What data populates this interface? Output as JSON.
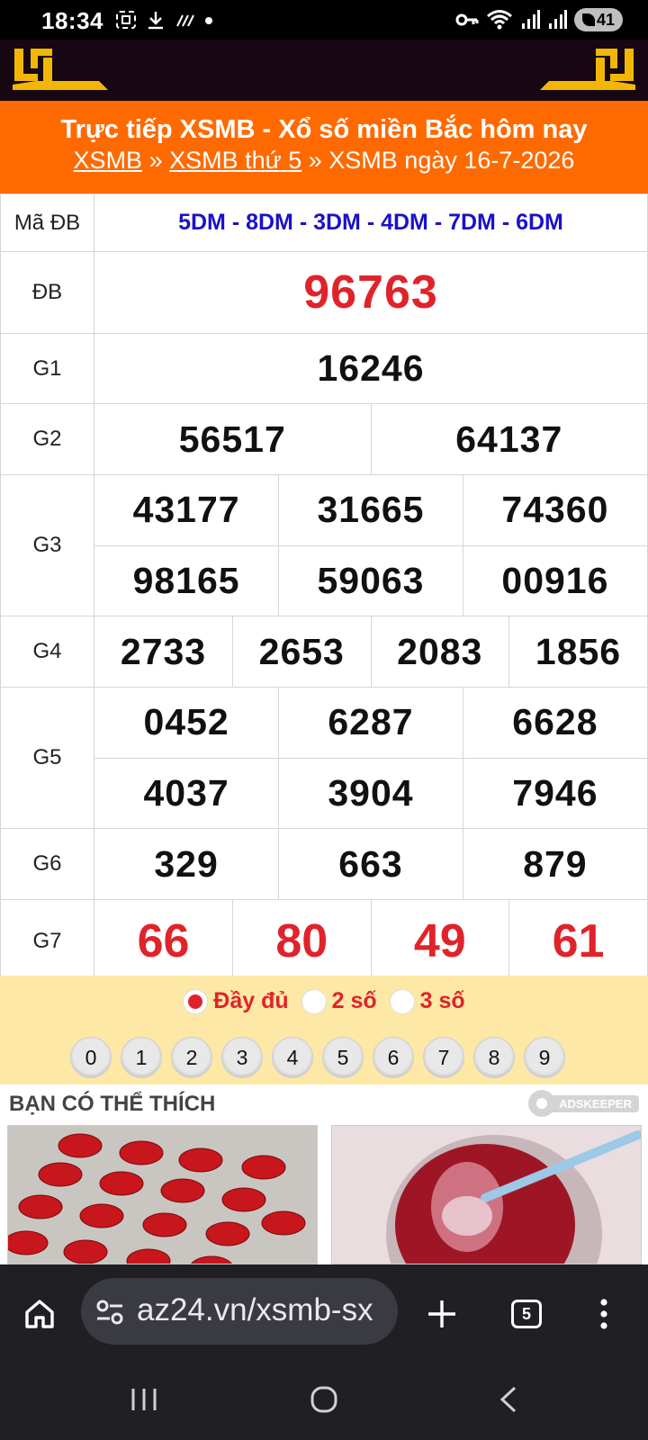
{
  "status_bar": {
    "time": "18:34",
    "battery": "41",
    "icons_left": [
      "screenshot-icon",
      "download-icon",
      "signal-hash-icon",
      "dot-icon"
    ],
    "icons_right": [
      "key-icon",
      "wifi-icon",
      "signal-icon",
      "signal-icon-2",
      "battery-icon"
    ]
  },
  "header": {
    "title": "Trực tiếp XSMB - Xổ số miền Bắc hôm nay",
    "breadcrumb": {
      "link1": "XSMB",
      "sep1": " » ",
      "link2": "XSMB thứ 5",
      "sep2": " » ",
      "current": "XSMB ngày 16-7-2026"
    }
  },
  "results": {
    "code_label": "Mã ĐB",
    "code_value": "5DM - 8DM - 3DM - 4DM - 7DM - 6DM",
    "db": {
      "label": "ĐB",
      "value": "96763"
    },
    "g1": {
      "label": "G1",
      "values": [
        "16246"
      ]
    },
    "g2": {
      "label": "G2",
      "values": [
        "56517",
        "64137"
      ]
    },
    "g3": {
      "label": "G3",
      "values": [
        "43177",
        "31665",
        "74360",
        "98165",
        "59063",
        "00916"
      ]
    },
    "g4": {
      "label": "G4",
      "values": [
        "2733",
        "2653",
        "2083",
        "1856"
      ]
    },
    "g5": {
      "label": "G5",
      "values": [
        "0452",
        "6287",
        "6628",
        "4037",
        "3904",
        "7946"
      ]
    },
    "g6": {
      "label": "G6",
      "values": [
        "329",
        "663",
        "879"
      ]
    },
    "g7": {
      "label": "G7",
      "values": [
        "66",
        "80",
        "49",
        "61"
      ]
    }
  },
  "filter": {
    "options": [
      "Đầy đủ",
      "2 số",
      "3 số"
    ],
    "selected": "Đầy đủ",
    "digits": [
      "0",
      "1",
      "2",
      "3",
      "4",
      "5",
      "6",
      "7",
      "8",
      "9"
    ]
  },
  "recommendations": {
    "title": "BẠN CÓ THỂ THÍCH",
    "ad_brand": "ADSKEEPER"
  },
  "browser": {
    "url": "az24.vn/xsmb-sx",
    "tab_count": "5"
  },
  "colors": {
    "header_orange": "#ff6a00",
    "highlight_red": "#e0232b",
    "code_blue": "#1a11c9",
    "filter_bg": "#fde8a6"
  }
}
